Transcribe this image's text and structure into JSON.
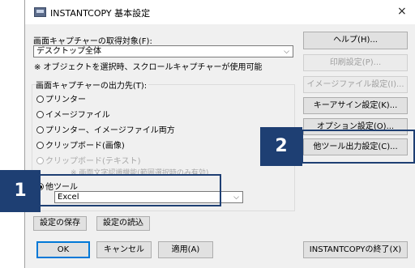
{
  "window": {
    "title": "INSTANTCOPY 基本設定",
    "close_glyph": "×"
  },
  "capture_target": {
    "label": "画面キャプチャーの取得対象(F):",
    "value": "デスクトップ全体",
    "note": "※ オブジェクトを選択時、スクロールキャプチャーが使用可能"
  },
  "output_group": {
    "label": "画面キャプチャーの出力先(T):",
    "options": [
      {
        "label": "プリンター",
        "checked": false,
        "enabled": true
      },
      {
        "label": "イメージファイル",
        "checked": false,
        "enabled": true
      },
      {
        "label": "プリンター、イメージファイル両方",
        "checked": false,
        "enabled": true
      },
      {
        "label": "クリップボード(画像)",
        "checked": false,
        "enabled": true
      },
      {
        "label": "クリップボード(テキスト)",
        "checked": false,
        "enabled": false
      }
    ],
    "disabled_note": "※ 画面文字認識機能(範囲選択時のみ有効)",
    "other_tool": {
      "label": "他ツール",
      "checked": true,
      "selected_tool": "Excel"
    }
  },
  "right_buttons": [
    {
      "label": "ヘルプ(H)...",
      "enabled": true
    },
    {
      "label": "印刷設定(P)...",
      "enabled": false
    },
    {
      "label": "イメージファイル設定(I)...",
      "enabled": false
    },
    {
      "label": "キーアサイン設定(K)...",
      "enabled": true
    },
    {
      "label": "オプション設定(O)...",
      "enabled": true
    },
    {
      "label": "他ツール出力設定(C)...",
      "enabled": true
    }
  ],
  "settings_buttons": {
    "save": "設定の保存",
    "load": "設定の読込"
  },
  "bottom_buttons": {
    "ok": "OK",
    "cancel": "キャンセル",
    "apply": "適用(A)",
    "exit": "INSTANTCOPYの終了(X)"
  },
  "callouts": {
    "one": "1",
    "two": "2",
    "color": "#1e3f73"
  }
}
